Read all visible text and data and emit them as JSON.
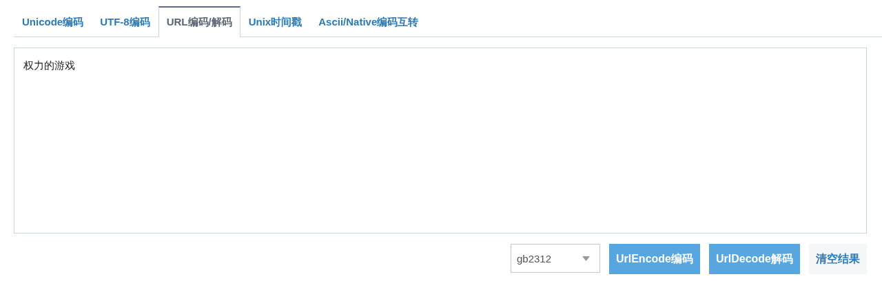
{
  "tabs": [
    {
      "label": "Unicode编码",
      "selected": false
    },
    {
      "label": "UTF-8编码",
      "selected": false
    },
    {
      "label": "URL编码/解码",
      "selected": true
    },
    {
      "label": "Unix时间戳",
      "selected": false
    },
    {
      "label": "Ascii/Native编码互转",
      "selected": false
    }
  ],
  "input": {
    "value": "权力的游戏"
  },
  "charset": {
    "value": "gb2312"
  },
  "buttons": [
    {
      "label": "UrlEncode编码",
      "kind": "primary"
    },
    {
      "label": "UrlDecode解码",
      "kind": "primary"
    },
    {
      "label": "清空结果",
      "kind": "plain"
    }
  ]
}
